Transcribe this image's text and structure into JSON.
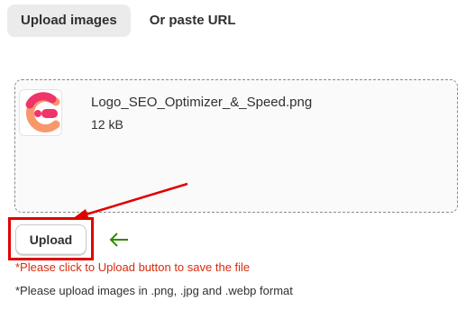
{
  "tabs": [
    {
      "label": "Upload images",
      "active": true
    },
    {
      "label": "Or paste URL",
      "active": false
    }
  ],
  "file": {
    "name": "Logo_SEO_Optimizer_&_Speed.png",
    "size": "12 kB",
    "thumbnail_icon": "seo-optimizer-logo-icon"
  },
  "upload_button": {
    "label": "Upload"
  },
  "notes": {
    "instruction": "*Please click to Upload button to save the file",
    "format": "*Please upload images in .png, .jpg and .webp format"
  },
  "colors": {
    "annotation_red": "#e00000",
    "note_red": "#d72c0d",
    "arrow_green": "#2e8b00",
    "logo_pink": "#f0346a",
    "logo_orange": "#f7986b"
  },
  "annotations": {
    "red_arrow_icon": "red-arrow-icon",
    "green_arrow_icon": "left-arrow-icon"
  }
}
